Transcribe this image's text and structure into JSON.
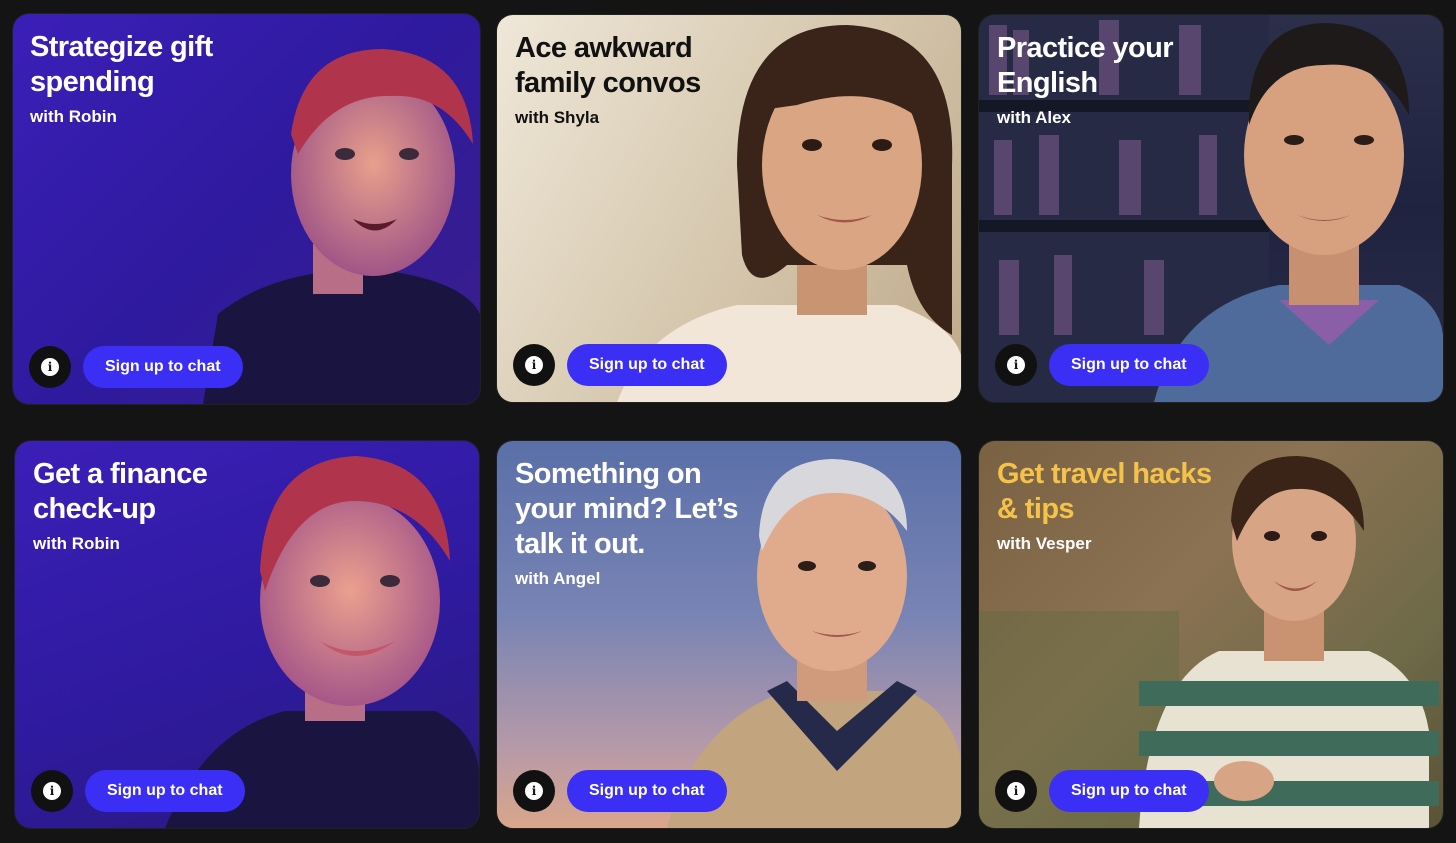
{
  "cards": [
    {
      "title_line1": "Strategize gift",
      "title_line2": "spending",
      "title_line3": "",
      "subtitle": "with Robin",
      "title_color": "#ffffff",
      "icon": "info-icon",
      "cta": "Sign up to chat"
    },
    {
      "title_line1": "Ace awkward",
      "title_line2": "family convos",
      "title_line3": "",
      "subtitle": "with Shyla",
      "title_color": "#111111",
      "icon": "info-icon",
      "cta": "Sign up to chat"
    },
    {
      "title_line1": "Practice your",
      "title_line2": "English",
      "title_line3": "",
      "subtitle": "with Alex",
      "title_color": "#ffffff",
      "icon": "info-icon",
      "cta": "Sign up to chat"
    },
    {
      "title_line1": "Get a finance",
      "title_line2": "check-up",
      "title_line3": "",
      "subtitle": "with Robin",
      "title_color": "#ffffff",
      "icon": "info-icon",
      "cta": "Sign up to chat"
    },
    {
      "title_line1": "Something on",
      "title_line2": "your mind? Let’s",
      "title_line3": "talk it out.",
      "subtitle": "with Angel",
      "title_color": "#ffffff",
      "icon": "info-icon",
      "cta": "Sign up to chat"
    },
    {
      "title_line1": "Get travel hacks",
      "title_line2": "& tips",
      "title_line3": "",
      "subtitle": "with Vesper",
      "title_color": "#f5c24a",
      "icon": "info-icon",
      "cta": "Sign up to chat"
    }
  ],
  "colors": {
    "page_bg": "#141414",
    "button": "#3b2ef5",
    "info_bg": "#111111"
  }
}
